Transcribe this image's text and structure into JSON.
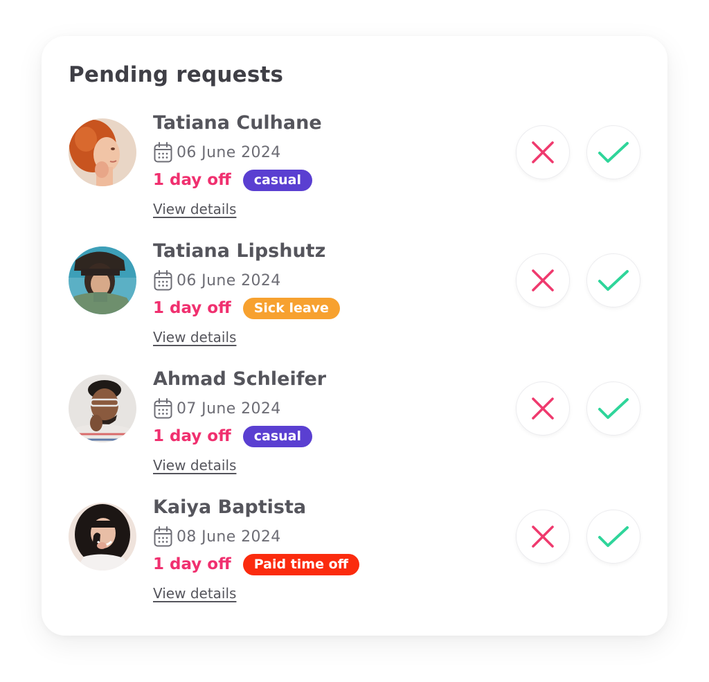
{
  "header": {
    "title": "Pending requests"
  },
  "colors": {
    "duration": "#f0306f",
    "reject_icon": "#ef3a6e",
    "accept_icon": "#2fd59a",
    "tag_casual": "#5a3fd1",
    "tag_sick_leave": "#f7a12f",
    "tag_paid_time_off": "#fb2b0e"
  },
  "requests": [
    {
      "name": "Tatiana Culhane",
      "date": "06 June 2024",
      "duration": "1 day off",
      "tag": "casual",
      "details_label": "View details"
    },
    {
      "name": "Tatiana Lipshutz",
      "date": "06 June 2024",
      "duration": "1 day off",
      "tag": "Sick leave",
      "details_label": "View details"
    },
    {
      "name": "Ahmad Schleifer",
      "date": "07 June 2024",
      "duration": "1 day off",
      "tag": "casual",
      "details_label": "View details"
    },
    {
      "name": "Kaiya Baptista",
      "date": "08 June 2024",
      "duration": "1 day off",
      "tag": "Paid time off",
      "details_label": "View details"
    }
  ],
  "icons": {
    "date": "calendar-icon",
    "reject": "close-icon",
    "accept": "check-icon"
  }
}
